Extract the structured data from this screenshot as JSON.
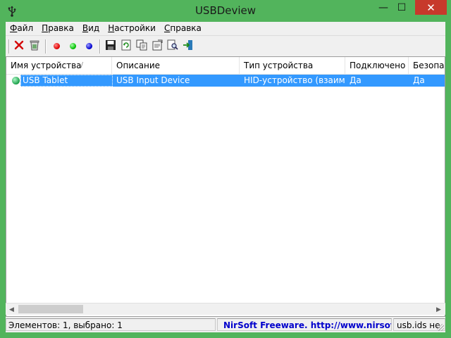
{
  "window": {
    "title": "USBDeview",
    "minimize_symbol": "—",
    "maximize_symbol": "☐",
    "close_symbol": "✕",
    "frame_color": "#52b45c",
    "close_color": "#c7392b"
  },
  "menu": {
    "items": [
      {
        "hotkey": "Ф",
        "rest": "айл"
      },
      {
        "hotkey": "П",
        "rest": "равка"
      },
      {
        "hotkey": "В",
        "rest": "ид"
      },
      {
        "hotkey": "Н",
        "rest": "астройки"
      },
      {
        "hotkey": "С",
        "rest": "правка"
      }
    ]
  },
  "toolbar": {
    "buttons": [
      {
        "icon": "disconnect-icon"
      },
      {
        "icon": "uninstall-icon"
      },
      {
        "icon": "red-dot-icon",
        "color": "#e00000"
      },
      {
        "icon": "green-dot-icon",
        "color": "#00c000"
      },
      {
        "icon": "blue-dot-icon",
        "color": "#0000d0"
      },
      {
        "icon": "save-icon"
      },
      {
        "icon": "refresh-icon"
      },
      {
        "icon": "copy-icon"
      },
      {
        "icon": "properties-icon"
      },
      {
        "icon": "find-icon"
      },
      {
        "icon": "exit-icon"
      }
    ]
  },
  "list": {
    "columns": [
      "Имя устройства",
      "Описание",
      "Тип устройства",
      "Подключено",
      "Безопас"
    ],
    "sort_indicator": "/",
    "rows": [
      {
        "name": "USB Tablet",
        "description": "USB Input Device",
        "type": "HID-устройство (взаим…",
        "connected": "Да",
        "safe": "Да",
        "status_color": "#1aa04a"
      }
    ],
    "selection_color": "#3399ff"
  },
  "scrollbar": {
    "left_arrow": "◀",
    "right_arrow": "▶"
  },
  "status": {
    "count_text": "Элементов: 1, выбрано: 1",
    "nirsoft_text": "NirSoft Freeware.  http://www.nirsoft.net",
    "usbids_text": "usb.ids не"
  }
}
